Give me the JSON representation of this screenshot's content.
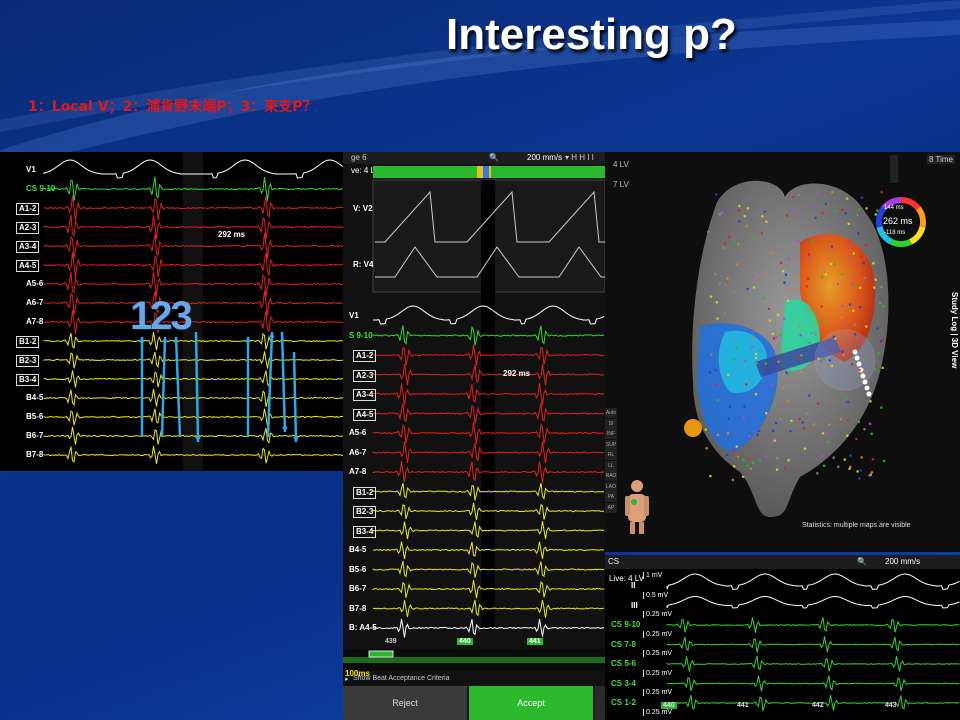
{
  "slide": {
    "title": "Interesting  p?",
    "subtitle": "1：Local V；2：浦肯野末端P；3：束支P？"
  },
  "left_panel": {
    "channels": [
      "V1",
      "CS 9-10",
      "A1-2",
      "A2-3",
      "A3-4",
      "A4-5",
      "A5-6",
      "A6-7",
      "A7-8",
      "B1-2",
      "B2-3",
      "B3-4",
      "B4-5",
      "B5-6",
      "B6-7",
      "B7-8"
    ],
    "interval": "292 ms",
    "annotation": "123"
  },
  "middle_panel": {
    "header_left": "ge 6",
    "header_sub": "ve: 4 LV",
    "speed": "200 mm/s",
    "top_channels": [
      "V: V2",
      "R: V4"
    ],
    "channels": [
      "V1",
      "S 9-10",
      "A1-2",
      "A2-3",
      "A3-4",
      "A4-5",
      "A5-6",
      "A6-7",
      "A7-8",
      "B1-2",
      "B2-3",
      "B3-4",
      "B4-5",
      "B5-6",
      "B6-7",
      "B7-8",
      "B: A4-5"
    ],
    "scale_label": "100ms",
    "interval": "292 ms",
    "beat_labels": [
      "439",
      "440",
      "441"
    ],
    "acceptance_label": "Show Beat Acceptance Criteria",
    "reject_label": "Reject",
    "accept_label": "Accept"
  },
  "map_panel": {
    "label_lines": [
      "4 LV",
      "7 LV"
    ],
    "time_label": "8 Time",
    "colorbar_top": "144 ms",
    "colorbar_mid": "262 ms",
    "colorbar_bottom": "-118 ms",
    "side_tab": "Study Log | 3D View",
    "statistics": "Statistics: multiple maps are visible",
    "tools": [
      "Auto",
      "SI",
      "INF",
      "SUP",
      "RL",
      "LL",
      "RAO",
      "LAO",
      "PA",
      "AP"
    ]
  },
  "bottom_right_panel": {
    "header_label": "CS",
    "live_label": "Live: 4 LV",
    "speed": "200 mm/s",
    "scales": [
      "1 mV",
      "0.5 mV",
      "0.25 mV",
      "0.25 mV",
      "0.25 mV",
      "0.25 mV",
      "0.25 mV",
      "0.25 mV"
    ],
    "channels": [
      "II",
      "III",
      "CS 9-10",
      "CS 7-8",
      "CS 5-6",
      "CS 3-4",
      "CS 1-2"
    ],
    "beat_labels": [
      "440",
      "441",
      "442",
      "443"
    ]
  },
  "colors": {
    "title": "#ffffff",
    "subtitle": "#e01818",
    "ecg": "#ffffff",
    "cs": "#33d633",
    "a_channels": "#e02020",
    "b_channels": "#e8e81a",
    "arrow": "#2ea8e6",
    "accept": "#2db92d"
  }
}
